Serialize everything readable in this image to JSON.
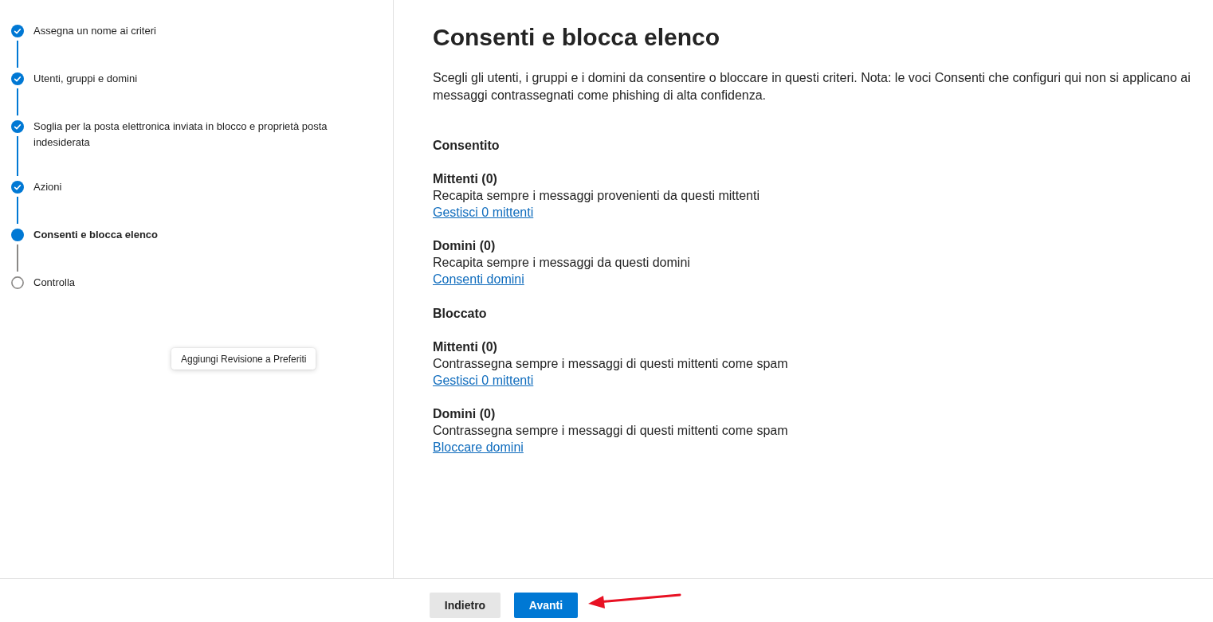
{
  "steps": [
    {
      "label": "Assegna un nome ai criteri",
      "completed": true,
      "selected": false
    },
    {
      "label": "Utenti, gruppi e domini",
      "completed": true,
      "selected": false
    },
    {
      "label": "Soglia per la posta elettronica inviata in blocco e proprietà posta indesiderata",
      "completed": true,
      "selected": false
    },
    {
      "label": "Azioni",
      "completed": true,
      "selected": false
    },
    {
      "label": "Consenti e blocca elenco",
      "completed": false,
      "selected": true
    },
    {
      "label": "Controlla",
      "completed": false,
      "selected": false
    }
  ],
  "tooltip": {
    "text": "Aggiungi Revisione a Preferiti"
  },
  "page": {
    "title": "Consenti e blocca elenco",
    "description": "Scegli gli utenti, i gruppi e i domini da consentire o bloccare in questi criteri. Nota: le voci Consenti che configuri qui non si applicano ai messaggi contrassegnati come phishing di alta confidenza.",
    "sections": [
      {
        "heading": "Consentito",
        "groups": [
          {
            "title": "Mittenti (0)",
            "description": "Recapita sempre i messaggi provenienti da questi mittenti",
            "link": "Gestisci 0 mittenti"
          },
          {
            "title": "Domini (0)",
            "description": "Recapita sempre i messaggi da questi domini",
            "link": "Consenti domini"
          }
        ]
      },
      {
        "heading": "Bloccato",
        "groups": [
          {
            "title": "Mittenti (0)",
            "description": "Contrassegna sempre i messaggi di questi mittenti come spam",
            "link": "Gestisci 0 mittenti"
          },
          {
            "title": "Domini (0)",
            "description": "Contrassegna sempre i messaggi di questi mittenti come spam",
            "link": "Bloccare domini"
          }
        ]
      }
    ]
  },
  "footer": {
    "buttons": [
      {
        "label": "Indietro",
        "kind": "secondary"
      },
      {
        "label": "Avanti",
        "kind": "primary"
      }
    ]
  }
}
